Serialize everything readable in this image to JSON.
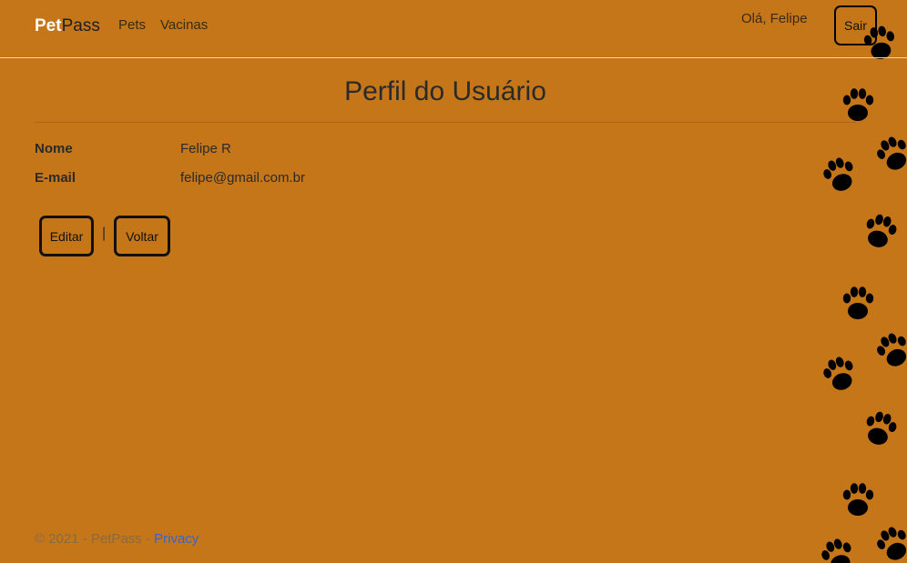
{
  "brand": {
    "bold": "Pet",
    "light": "Pass"
  },
  "nav": {
    "items": [
      {
        "label": "Pets"
      },
      {
        "label": "Vacinas"
      }
    ],
    "greeting": "Olá, Felipe",
    "logout_label": "Sair"
  },
  "profile": {
    "title": "Perfil do Usuário",
    "fields": [
      {
        "label": "Nome",
        "value": "Felipe R"
      },
      {
        "label": "E-mail",
        "value": "felipe@gmail.com.br"
      }
    ],
    "edit_label": "Editar",
    "separator": "|",
    "back_label": "Voltar"
  },
  "footer": {
    "text": "© 2021 - PetPass - ",
    "link": "Privacy"
  },
  "colors": {
    "background": "#c47619",
    "link": "#3c63c9",
    "paw": "#000000"
  }
}
